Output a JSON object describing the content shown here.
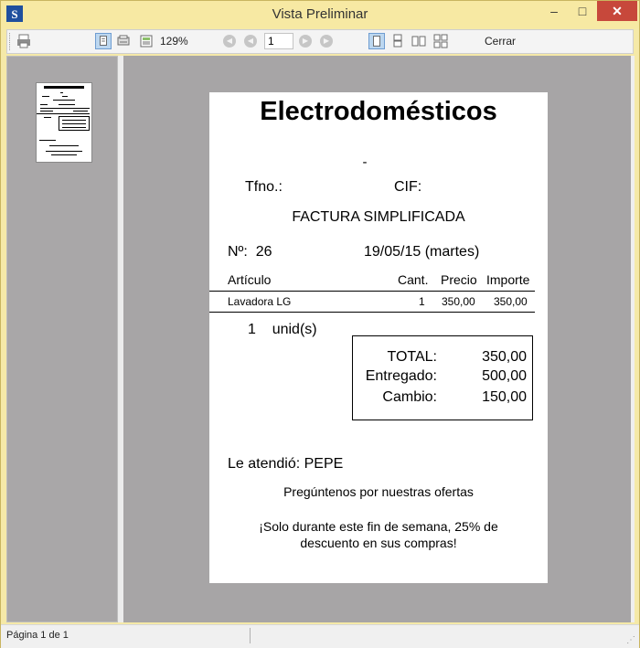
{
  "window": {
    "title": "Vista Preliminar",
    "minimize": "–",
    "maximize": "□",
    "close": "✕"
  },
  "toolbar": {
    "zoom": "129%",
    "page_value": "1",
    "close_label": "Cerrar"
  },
  "receipt": {
    "store_name": "Electrodomésticos",
    "address_line": "-",
    "tfno_label": "Tfno.:",
    "cif_label": "CIF:",
    "doc_type": "FACTURA SIMPLIFICADA",
    "number_label": "Nº:",
    "number": "26",
    "date": "19/05/15 (martes)",
    "columns": {
      "article": "Artículo",
      "qty": "Cant.",
      "price": "Precio",
      "amount": "Importe"
    },
    "items": [
      {
        "article": "Lavadora LG",
        "qty": "1",
        "price": "350,00",
        "amount": "350,00"
      }
    ],
    "units_count": "1",
    "units_label": "unid(s)",
    "totals": {
      "total_label": "TOTAL:",
      "total": "350,00",
      "paid_label": "Entregado:",
      "paid": "500,00",
      "change_label": "Cambio:",
      "change": "150,00"
    },
    "attended": "Le atendió: PEPE",
    "promo_line": "Pregúntenos por nuestras ofertas",
    "promo_line2a": "¡Solo durante este fin de semana, 25% de",
    "promo_line2b": "descuento en sus compras!"
  },
  "status": {
    "page_info": "Página 1 de 1"
  }
}
